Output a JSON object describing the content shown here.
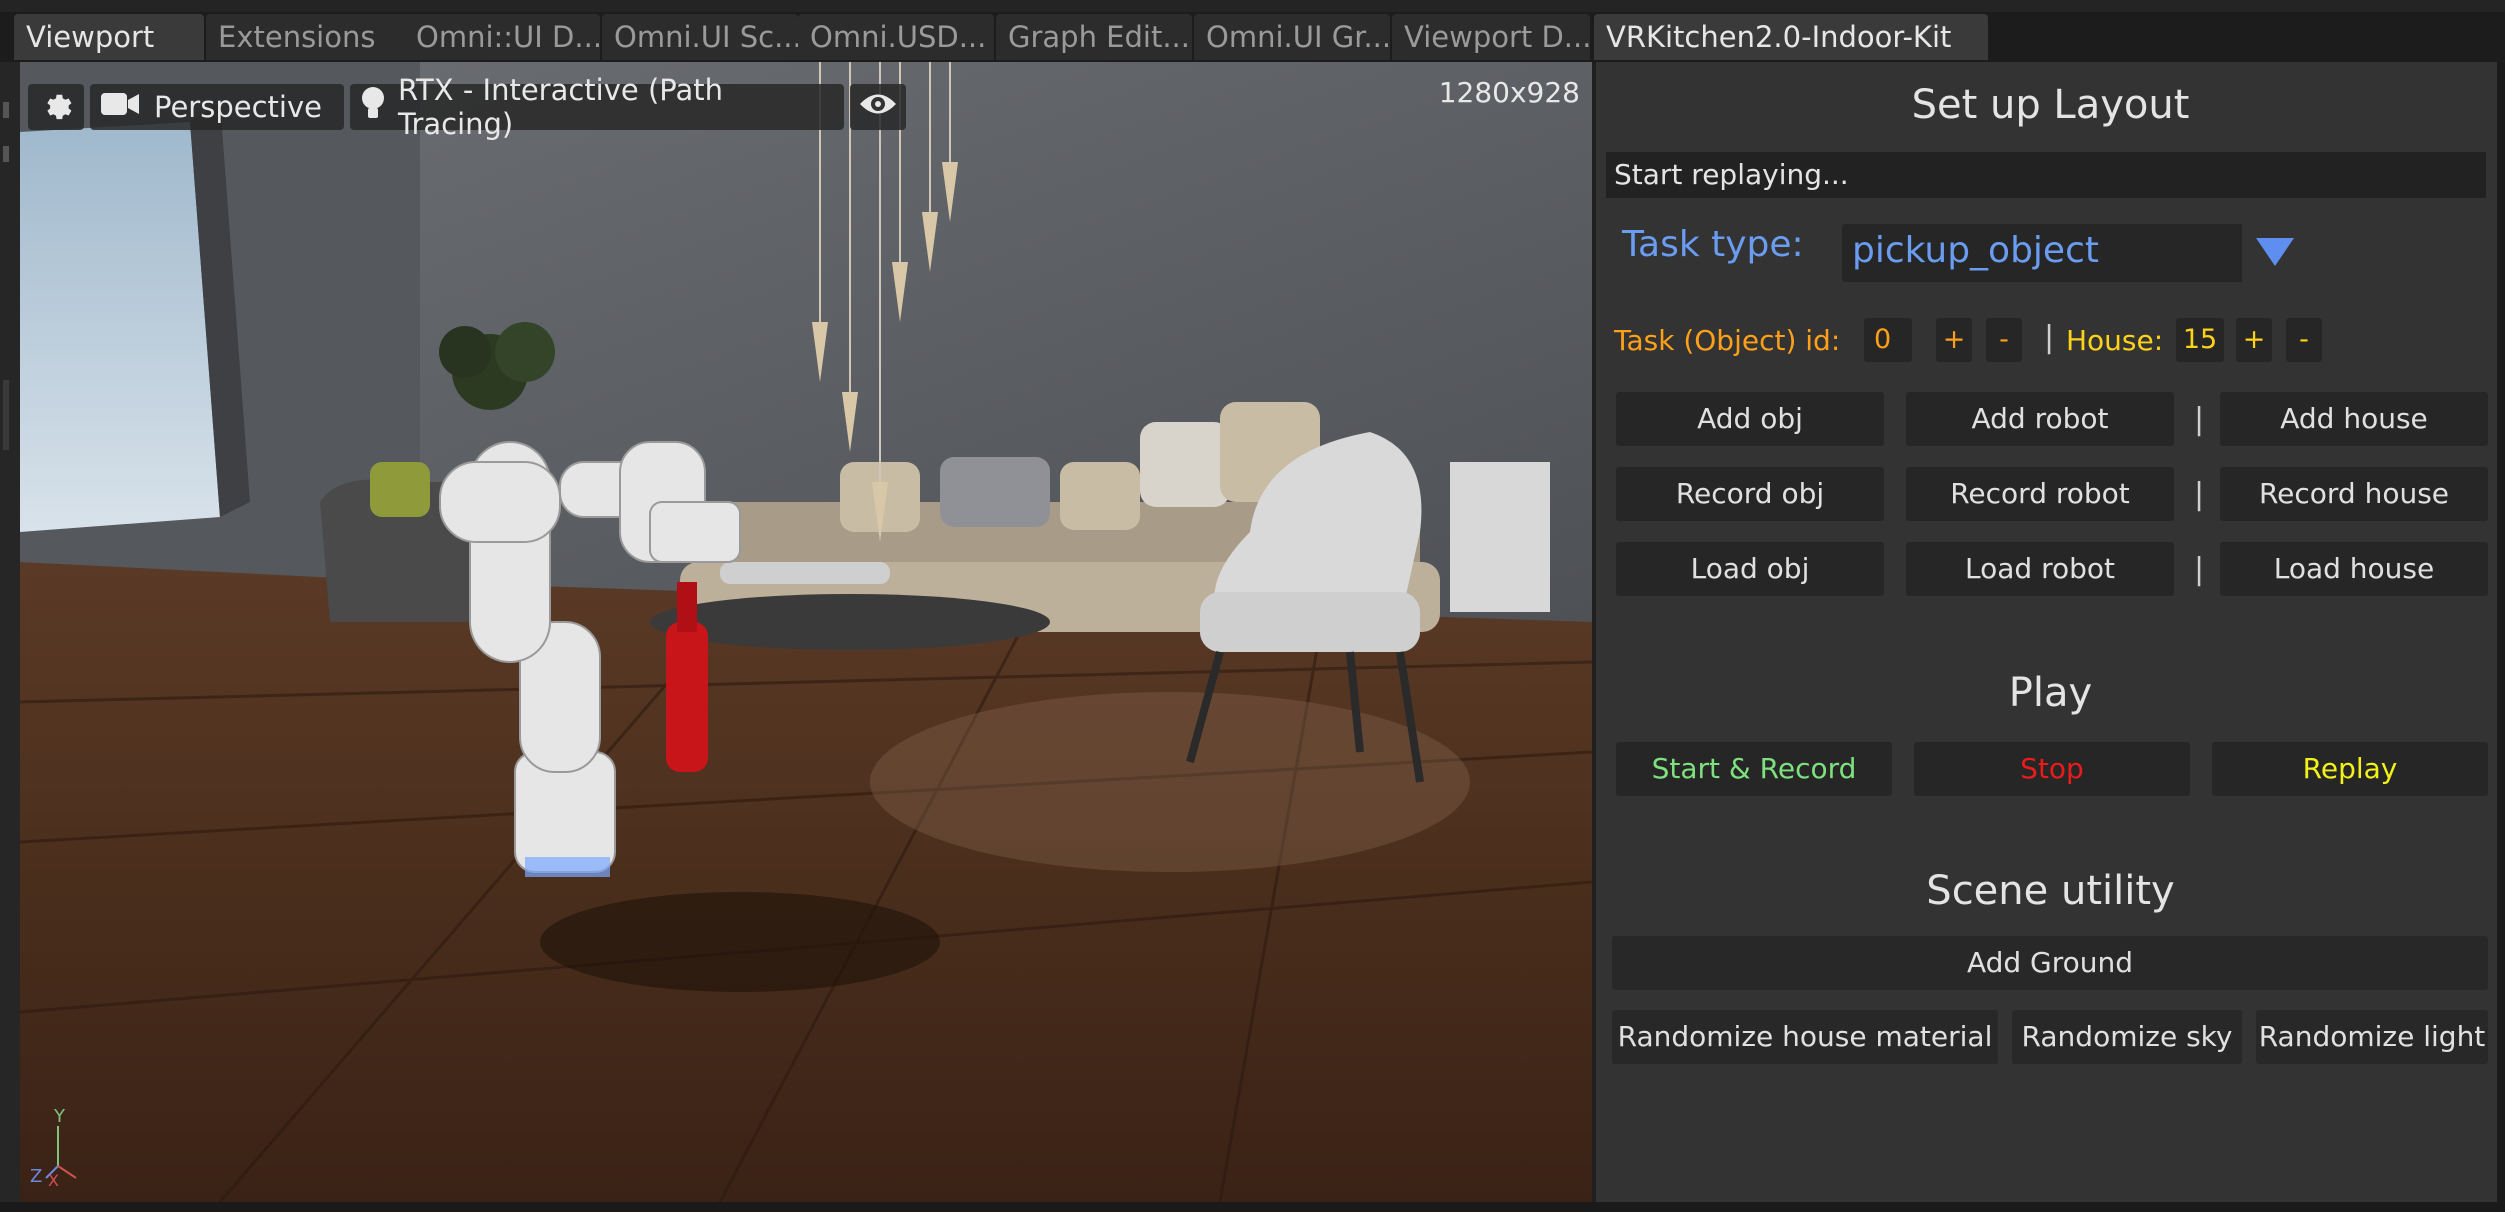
{
  "tabs": [
    {
      "label": "Viewport",
      "active": true
    },
    {
      "label": "Extensions",
      "active": false
    },
    {
      "label": "Omni::UI D...",
      "active": false
    },
    {
      "label": "Omni.UI Sc...",
      "active": false
    },
    {
      "label": "Omni.USD...",
      "active": false
    },
    {
      "label": "Graph Edit...",
      "active": false
    },
    {
      "label": "Omni.UI Gr...",
      "active": false
    },
    {
      "label": "Viewport D...",
      "active": false
    },
    {
      "label": "VRKitchen2.0-Indoor-Kit",
      "active": true
    }
  ],
  "viewport": {
    "camera_label": "Perspective",
    "renderer_label": "RTX - Interactive (Path Tracing)",
    "resolution": "1280x928",
    "axis": {
      "y": "Y",
      "z": "Z",
      "x": "X"
    }
  },
  "panel": {
    "setup_title": "Set up Layout",
    "status": "Start replaying...",
    "task_type_label": "Task type:",
    "task_type_value": "pickup_object",
    "task_id_label": "Task (Object) id:",
    "task_id_value": "0",
    "house_label": "House:",
    "house_value": "15",
    "plus": "+",
    "minus": "-",
    "pipe": "|",
    "add_obj": "Add obj",
    "add_robot": "Add robot",
    "add_house": "Add house",
    "record_obj": "Record obj",
    "record_robot": "Record robot",
    "record_house": "Record house",
    "load_obj": "Load obj",
    "load_robot": "Load robot",
    "load_house": "Load house",
    "play_title": "Play",
    "start_record": "Start & Record",
    "stop": "Stop",
    "replay": "Replay",
    "scene_title": "Scene utility",
    "add_ground": "Add Ground",
    "rand_house_material": "Randomize house material",
    "rand_sky": "Randomize sky",
    "rand_light": "Randomize light"
  },
  "colors": {
    "task_type_blue": "#6a9cf0",
    "orange": "#ff9f1a",
    "yellow": "#ffd21a",
    "green": "#7ee07e",
    "red": "#e81c1c",
    "replay_yellow": "#f2f21a"
  }
}
